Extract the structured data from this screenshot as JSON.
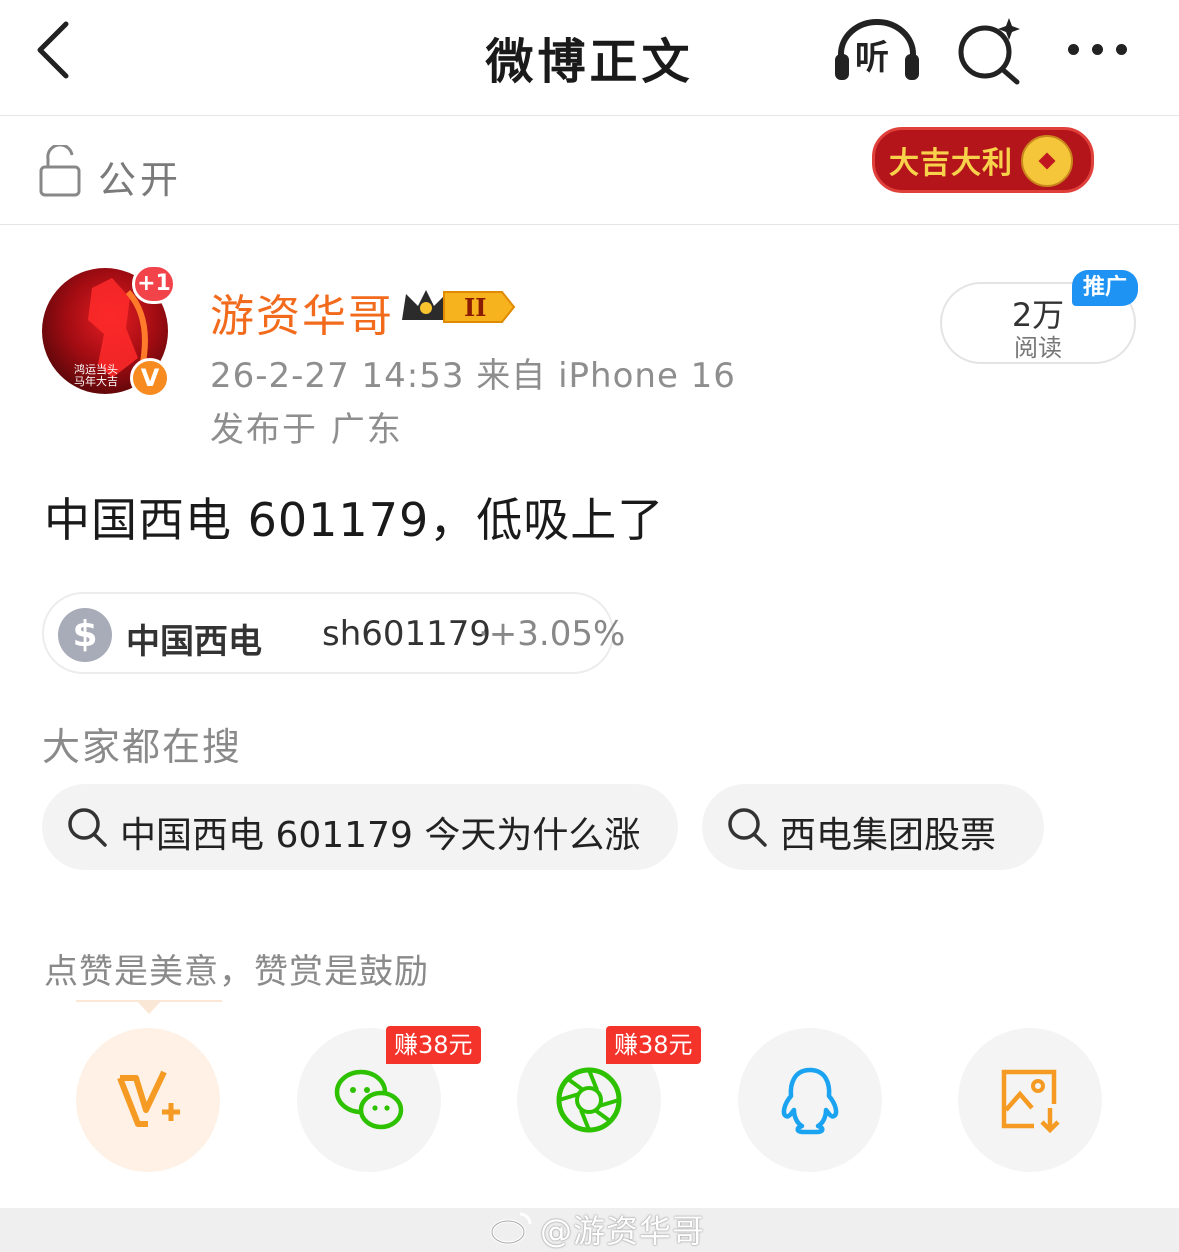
{
  "nav": {
    "title": "微博正文",
    "listen_label": "听"
  },
  "visibility": {
    "label": "公开",
    "banner_text": "大吉大利"
  },
  "post": {
    "author": "游资华哥",
    "avatar_caption_1": "鸿运当头",
    "avatar_caption_2": "马年大吉",
    "plus_badge": "+1",
    "verified_badge": "V",
    "vip_level": "II",
    "time_source": "26-2-27 14:53  来自 iPhone 16",
    "location": "发布于 广东",
    "reads_count": "2万",
    "reads_label": "阅读",
    "promo_label": "推广",
    "text": "中国西电 601179，低吸上了"
  },
  "stock": {
    "icon": "$",
    "name": "中国西电",
    "code": "sh601179",
    "change": "·+3.05%"
  },
  "hot_search": {
    "title": "大家都在搜",
    "items": [
      {
        "label": "中国西电 601179 今天为什么涨"
      },
      {
        "label": "西电集团股票"
      }
    ]
  },
  "reward": {
    "text": "点赞是美意，赞赏是鼓励"
  },
  "share": {
    "wechat_badge": "赚38元",
    "moments_badge": "赚38元"
  },
  "watermark": {
    "text": "@游资华哥"
  },
  "colors": {
    "author": "#f26b1d",
    "promo": "#1f93f3",
    "earn_badge": "#f4332b",
    "wechat_green": "#2dc100",
    "qq_blue": "#1aa3f0",
    "save_orange": "#f59a23"
  }
}
